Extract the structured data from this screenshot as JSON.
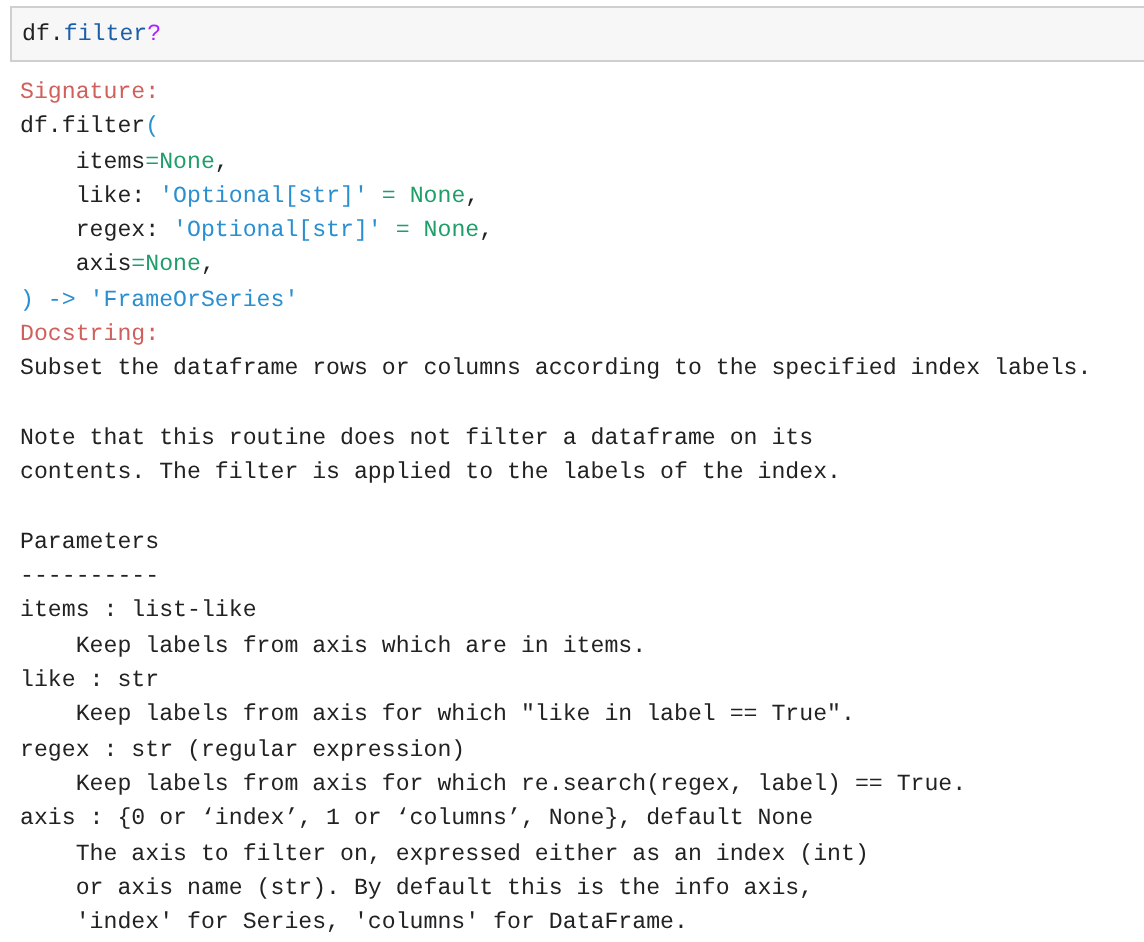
{
  "input_cell": {
    "tokens": [
      {
        "text": "df.",
        "kind": "plain"
      },
      {
        "text": "filter",
        "kind": "name"
      },
      {
        "text": "?",
        "kind": "operator"
      }
    ]
  },
  "output": {
    "signature_label": "Signature:",
    "signature_lines": [
      [
        {
          "text": "df.filter",
          "kind": "plain"
        },
        {
          "text": "(",
          "kind": "string"
        }
      ],
      [
        {
          "text": "    items",
          "kind": "plain"
        },
        {
          "text": "=None",
          "kind": "keyword"
        },
        {
          "text": ",",
          "kind": "plain"
        }
      ],
      [
        {
          "text": "    like: ",
          "kind": "plain"
        },
        {
          "text": "'Optional[str]'",
          "kind": "string"
        },
        {
          "text": " = None",
          "kind": "keyword"
        },
        {
          "text": ",",
          "kind": "plain"
        }
      ],
      [
        {
          "text": "    regex: ",
          "kind": "plain"
        },
        {
          "text": "'Optional[str]'",
          "kind": "string"
        },
        {
          "text": " = None",
          "kind": "keyword"
        },
        {
          "text": ",",
          "kind": "plain"
        }
      ],
      [
        {
          "text": "    axis",
          "kind": "plain"
        },
        {
          "text": "=None",
          "kind": "keyword"
        },
        {
          "text": ",",
          "kind": "plain"
        }
      ],
      [
        {
          "text": ") -> 'FrameOrSeries'",
          "kind": "string"
        }
      ]
    ],
    "docstring_label": "Docstring:",
    "docstring_paragraphs": [
      [
        "Subset the dataframe rows or columns according to the specified index labels."
      ],
      [
        "Note that this routine does not filter a dataframe on its",
        "contents. The filter is applied to the labels of the index."
      ],
      [
        "Parameters",
        "----------",
        "items : list-like",
        "    Keep labels from axis which are in items.",
        "like : str",
        "    Keep labels from axis for which \"like in label == True\".",
        "regex : str (regular expression)",
        "    Keep labels from axis for which re.search(regex, label) == True.",
        "axis : {0 or ‘index’, 1 or ‘columns’, None}, default None",
        "    The axis to filter on, expressed either as an index (int)",
        "    or axis name (str). By default this is the info axis,",
        "    'index' for Series, 'columns' for DataFrame."
      ]
    ]
  }
}
